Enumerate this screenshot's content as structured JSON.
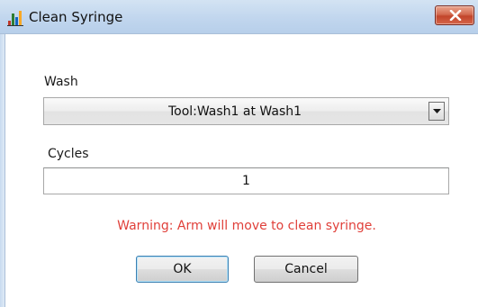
{
  "window": {
    "title": "Clean Syringe",
    "icon": "app-chart-icon",
    "close_icon": "close-x-icon"
  },
  "wash": {
    "label": "Wash",
    "selected": "Tool:Wash1 at Wash1",
    "dropdown_icon": "chevron-down-icon"
  },
  "cycles": {
    "label": "Cycles",
    "value": "1"
  },
  "warning": {
    "text": "Warning: Arm will move to clean syringe.",
    "color": "#e0403a"
  },
  "buttons": {
    "ok": "OK",
    "cancel": "Cancel"
  }
}
